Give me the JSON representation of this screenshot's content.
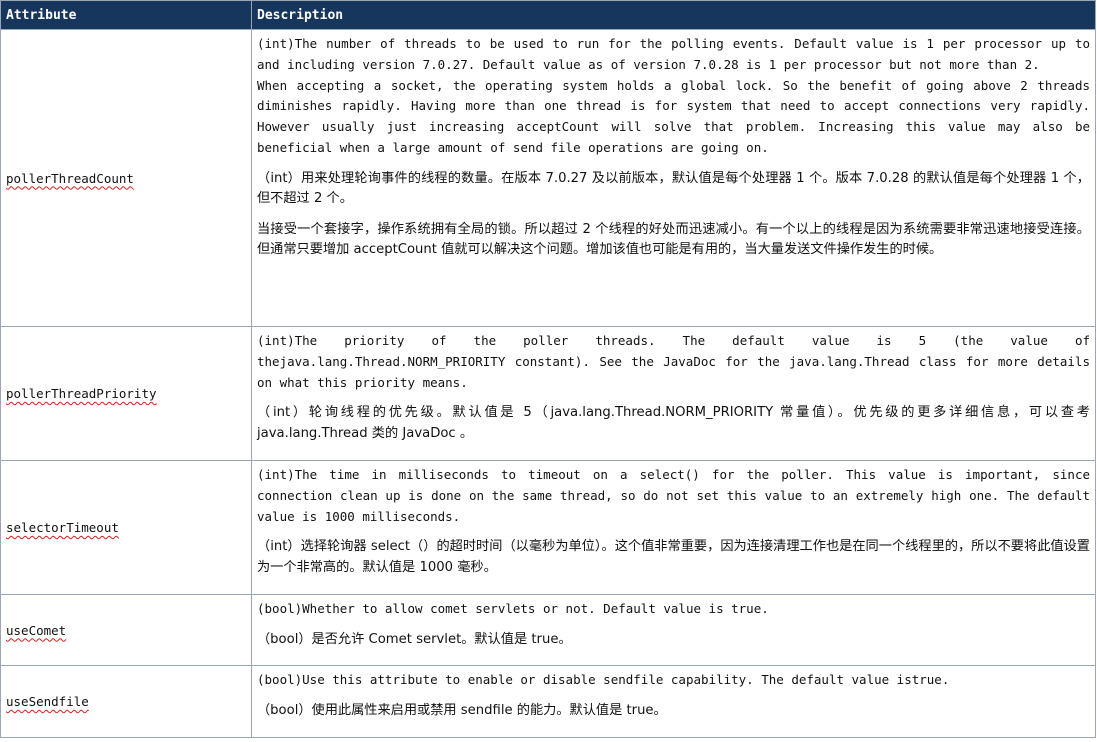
{
  "header": {
    "attribute": "Attribute",
    "description": "Description"
  },
  "rows": [
    {
      "attribute": "pollerThreadCount",
      "paragraphs": [
        "(int)The number of threads to be used to run for the polling events. Default value is  1  per processor up to and including version 7.0.27. Default value as of version 7.0.28 is  1  per processor but not more than 2.\nWhen accepting a socket, the operating system holds a global lock. So the benefit of going above 2 threads diminishes rapidly. Having more than one thread is for system that need to accept connections very rapidly. However usually just increasing  acceptCount  will solve that problem. Increasing this value may also be beneficial when a large amount of send file operations are going on.",
        "（int）用来处理轮询事件的线程的数量。在版本 7.0.27 及以前版本，默认值是每个处理器 1 个。版本 7.0.28 的默认值是每个处理器 1 个，但不超过 2 个。",
        "当接受一个套接字，操作系统拥有全局的锁。所以超过 2 个线程的好处而迅速减小。有一个以上的线程是因为系统需要非常迅速地接受连接。但通常只要增加 acceptCount 值就可以解决这个问题。增加该值也可能是有用的，当大量发送文件操作发生的时候。"
      ]
    },
    {
      "attribute": "pollerThreadPriority",
      "paragraphs": [
        "(int)The priority of the poller threads. The default value is  5  (the value of thejava.lang.Thread.NORM_PRIORITY  constant). See the JavaDoc for the  java.lang.Thread  class for more details on what this priority means.",
        "（int）轮询线程的优先级。默认值是 5（java.lang.Thread.NORM_PRIORITY 常量值）。优先级的更多详细信息，可以查考 java.lang.Thread 类的 JavaDoc 。"
      ]
    },
    {
      "attribute": "selectorTimeout",
      "paragraphs": [
        "(int)The time in milliseconds to timeout on a select() for the poller. This value is important, since connection clean up is done on the same thread, so do not set this value to an extremely high one. The default value is  1000  milliseconds.",
        "（int）选择轮询器 select（）的超时时间（以毫秒为单位）。这个值非常重要，因为连接清理工作也是在同一个线程里的，所以不要将此值设置为一个非常高的。默认值是 1000 毫秒。"
      ]
    },
    {
      "attribute": "useComet",
      "paragraphs": [
        "(bool)Whether to allow comet servlets or not. Default value is  true.",
        "（bool）是否允许 Comet servlet。默认值是 true。"
      ]
    },
    {
      "attribute": "useSendfile",
      "paragraphs": [
        "(bool)Use this attribute to enable or disable sendfile capability. The default value istrue.",
        "（bool）使用此属性来启用或禁用 sendfile 的能力。默认值是 true。"
      ]
    }
  ]
}
